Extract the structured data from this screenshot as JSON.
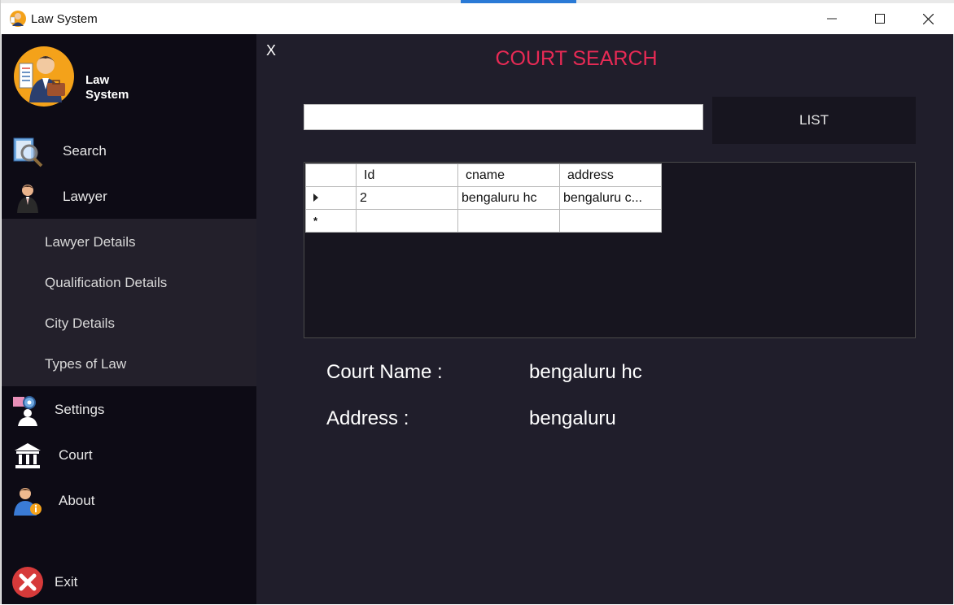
{
  "window": {
    "title": "Law System"
  },
  "brand": {
    "line1": "Law",
    "line2": "System"
  },
  "sidebar": {
    "items": [
      {
        "label": "Search",
        "icon": "magnifier-book-icon"
      },
      {
        "label": "Lawyer",
        "icon": "lawyer-person-icon"
      },
      {
        "label": "Settings",
        "icon": "settings-gear-person-icon"
      },
      {
        "label": "Court",
        "icon": "courthouse-icon"
      },
      {
        "label": "About",
        "icon": "person-info-icon"
      },
      {
        "label": "Exit",
        "icon": "red-x-circle-icon"
      }
    ],
    "submenu": [
      {
        "label": "Lawyer Details"
      },
      {
        "label": "Qualification Details"
      },
      {
        "label": "City Details"
      },
      {
        "label": "Types of Law"
      }
    ]
  },
  "main": {
    "close_label": "X",
    "heading": "COURT SEARCH",
    "search_value": "",
    "list_button": "LIST"
  },
  "grid": {
    "columns": [
      "Id",
      "cname",
      "address"
    ],
    "rows": [
      {
        "id": "2",
        "cname": "bengaluru hc",
        "address": "bengaluru c..."
      }
    ]
  },
  "details": {
    "court_name_label": "Court Name :",
    "court_name_value": "bengaluru hc",
    "address_label": "Address :",
    "address_value": "bengaluru"
  },
  "colors": {
    "sidebar_bg": "#0d0b15",
    "submenu_bg": "#23202b",
    "main_bg": "#201e2b",
    "heading_accent": "#e82a55",
    "button_bg": "#17151f"
  }
}
